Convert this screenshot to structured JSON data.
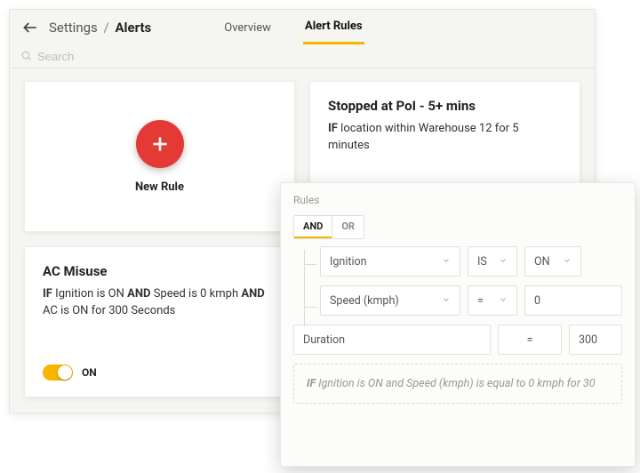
{
  "breadcrumb": {
    "parent": "Settings",
    "current": "Alerts"
  },
  "tabs": {
    "overview": "Overview",
    "alert_rules": "Alert Rules"
  },
  "search": {
    "placeholder": "Search"
  },
  "new_rule": {
    "label": "New Rule"
  },
  "card_poi": {
    "title": "Stopped at PoI - 5+ mins",
    "if": "IF",
    "desc_tail": " location within Warehouse 12 for 5 minutes"
  },
  "card_ac": {
    "title": "AC Misuse",
    "if1": "IF",
    "part1": " Ignition is ON ",
    "and": "AND",
    "part2": " Speed is 0 kmph ",
    "part3": " AC is ON for 300 Seconds",
    "toggle_state": "ON"
  },
  "rules_panel": {
    "heading": "Rules",
    "logic_and": "AND",
    "logic_or": "OR",
    "row1": {
      "field": "Ignition",
      "op": "IS",
      "val": "ON"
    },
    "row2": {
      "field": "Speed (kmph)",
      "op": "=",
      "val": "0"
    },
    "row3": {
      "field": "Duration",
      "op": "=",
      "val": "300"
    },
    "preview_if": "IF",
    "preview_tail": " Ignition is ON and Speed (kmph) is equal to 0 kmph for 30"
  }
}
